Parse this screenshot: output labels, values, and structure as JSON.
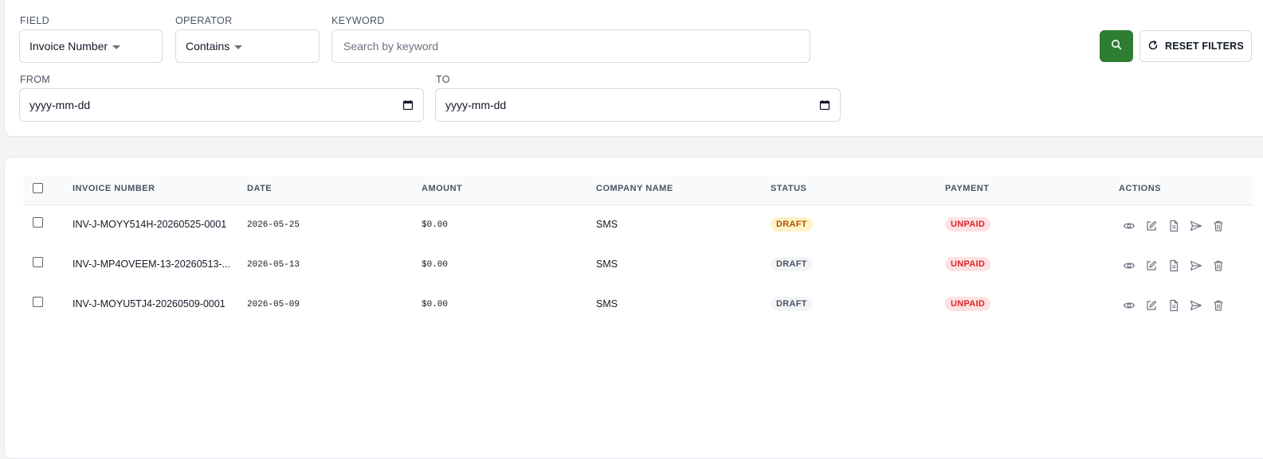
{
  "filters": {
    "field_label": "FIELD",
    "field_value": "Invoice Number",
    "operator_label": "OPERATOR",
    "operator_value": "Contains",
    "keyword_label": "KEYWORD",
    "keyword_placeholder": "Search by keyword",
    "from_label": "FROM",
    "from_value": "yyyy-mm-dd",
    "to_label": "TO",
    "to_value": "yyyy-mm-dd",
    "reset_label": "RESET FILTERS",
    "search_icon": "search-icon",
    "reset_icon": "refresh-icon",
    "accent_color": "#2e7d32"
  },
  "table": {
    "columns": [
      "INVOICE NUMBER",
      "DATE",
      "AMOUNT",
      "COMPANY NAME",
      "STATUS",
      "PAYMENT",
      "ACTIONS"
    ],
    "rows": [
      {
        "invoice": "INV-J-MOYY514H-20260525-0001",
        "date": "2026-05-25",
        "amount": "$0.00",
        "company": "SMS",
        "status": "DRAFT",
        "payment": "UNPAID"
      },
      {
        "invoice": "INV-J-MP4OVEEM-13-20260513-...",
        "date": "2026-05-13",
        "amount": "$0.00",
        "company": "SMS",
        "status": "DRAFT",
        "payment": "UNPAID"
      },
      {
        "invoice": "INV-J-MOYU5TJ4-20260509-0001",
        "date": "2026-05-09",
        "amount": "$0.00",
        "company": "SMS",
        "status": "DRAFT",
        "payment": "UNPAID"
      }
    ],
    "row_actions": [
      "view-icon",
      "edit-icon",
      "document-icon",
      "send-icon",
      "delete-icon"
    ],
    "status_colors": {
      "draft_highlight": "#b45309",
      "draft": "#4b5563",
      "unpaid": "#dc2626"
    }
  }
}
